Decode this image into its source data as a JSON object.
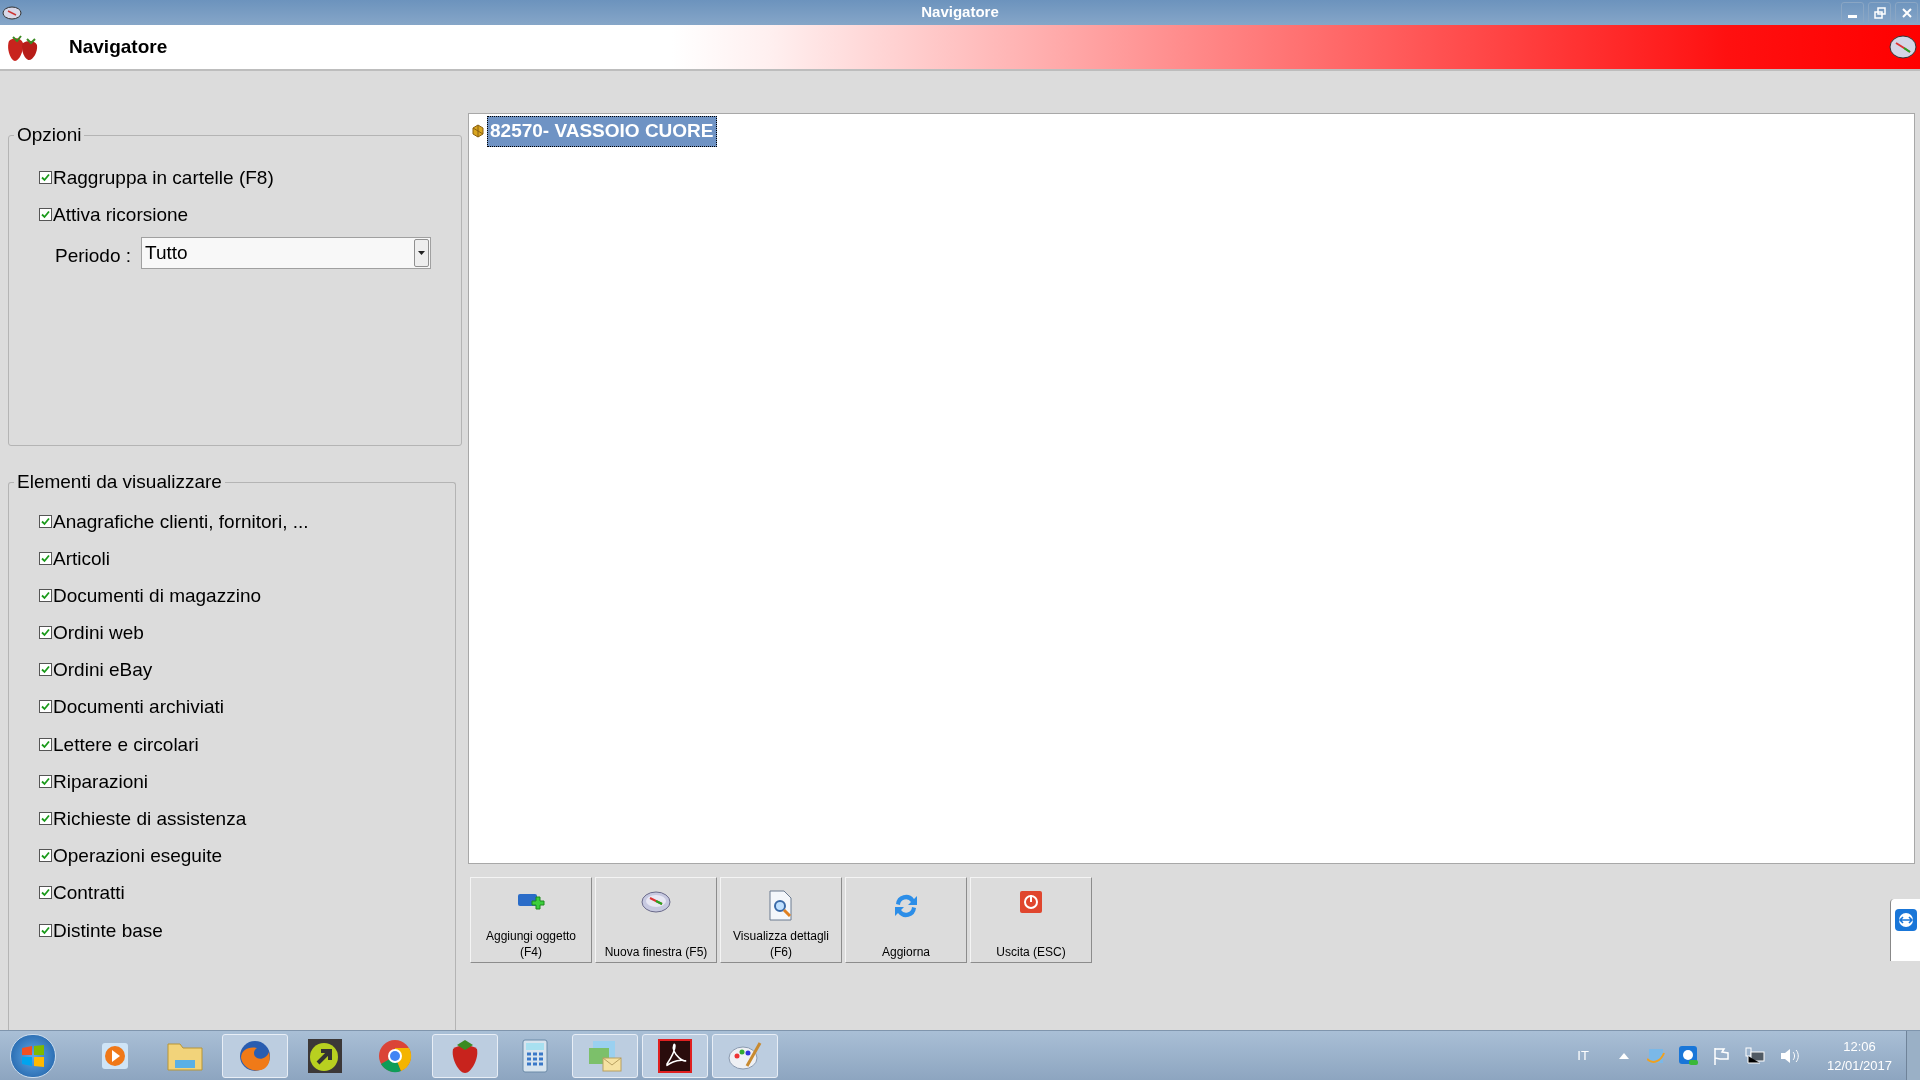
{
  "window": {
    "title": "Navigatore"
  },
  "header": {
    "title": "Navigatore"
  },
  "options": {
    "legend": "Opzioni",
    "checkboxes": [
      {
        "label": "Raggruppa in cartelle (F8)",
        "checked": true
      },
      {
        "label": "Attiva ricorsione",
        "checked": true
      }
    ],
    "period": {
      "label": "Periodo :",
      "value": "Tutto"
    }
  },
  "elements": {
    "legend": "Elementi da visualizzare",
    "checkboxes": [
      {
        "label": "Anagrafiche clienti, fornitori, ...",
        "checked": true
      },
      {
        "label": "Articoli",
        "checked": true
      },
      {
        "label": "Documenti di magazzino",
        "checked": true
      },
      {
        "label": "Ordini web",
        "checked": true
      },
      {
        "label": "Ordini eBay",
        "checked": true
      },
      {
        "label": "Documenti archiviati",
        "checked": true
      },
      {
        "label": "Lettere e circolari",
        "checked": true
      },
      {
        "label": "Riparazioni",
        "checked": true
      },
      {
        "label": "Richieste di assistenza",
        "checked": true
      },
      {
        "label": "Operazioni eseguite",
        "checked": true
      },
      {
        "label": "Contratti",
        "checked": true
      },
      {
        "label": "Distinte base",
        "checked": true
      }
    ]
  },
  "tree": {
    "items": [
      {
        "label": "82570- VASSOIO CUORE",
        "selected": true
      }
    ]
  },
  "buttons": [
    {
      "kind": "add",
      "label": "Aggiungi oggetto (F4)"
    },
    {
      "kind": "compass",
      "label": "Nuova finestra (F5)"
    },
    {
      "kind": "details",
      "label": "Visualizza dettagli (F6)"
    },
    {
      "kind": "refresh",
      "label": "Aggiorna"
    },
    {
      "kind": "exit",
      "label": "Uscita (ESC)"
    }
  ],
  "taskbar": {
    "language": "IT",
    "time": "12:06",
    "date": "12/01/2017"
  }
}
